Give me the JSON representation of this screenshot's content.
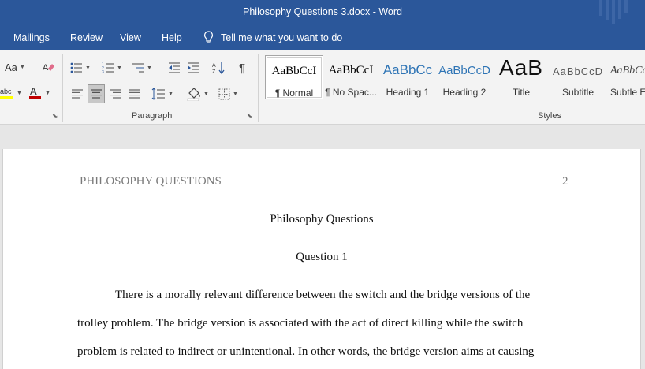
{
  "window": {
    "title": "Philosophy Questions 3.docx  -  Word"
  },
  "tabs": [
    {
      "label": "Mailings"
    },
    {
      "label": "Review"
    },
    {
      "label": "View"
    },
    {
      "label": "Help"
    }
  ],
  "tell_me": {
    "label": "Tell me what you want to do"
  },
  "ribbon": {
    "font_group": {
      "change_case_label": "Aa",
      "font_color": "#c00000",
      "highlight_color": "#ffff00",
      "highlight_label": "abc",
      "font_color_label": "A"
    },
    "paragraph_group": {
      "label": "Paragraph"
    },
    "styles_group": {
      "label": "Styles",
      "items": [
        {
          "sample": "AaBbCcI",
          "name": "¶ Normal",
          "selected": true
        },
        {
          "sample": "AaBbCcI",
          "name": "¶ No Spac..."
        },
        {
          "sample": "AaBbCc",
          "name": "Heading 1"
        },
        {
          "sample": "AaBbCcD",
          "name": "Heading 2"
        },
        {
          "sample": "AaB",
          "name": "Title"
        },
        {
          "sample": "AaBbCcD",
          "name": "Subtitle"
        },
        {
          "sample": "AaBbCcl",
          "name": "Subtle Em"
        }
      ]
    }
  },
  "document": {
    "header_left": "PHILOSOPHY QUESTIONS",
    "page_number": "2",
    "title": "Philosophy Questions",
    "question_heading": "Question 1",
    "body_lines": [
      "There is a morally relevant difference between the switch and the bridge versions of the",
      "trolley problem. The bridge version is associated with the act of direct killing while the switch",
      "problem is related to indirect or unintentional. In other words, the bridge version aims at causing"
    ]
  }
}
